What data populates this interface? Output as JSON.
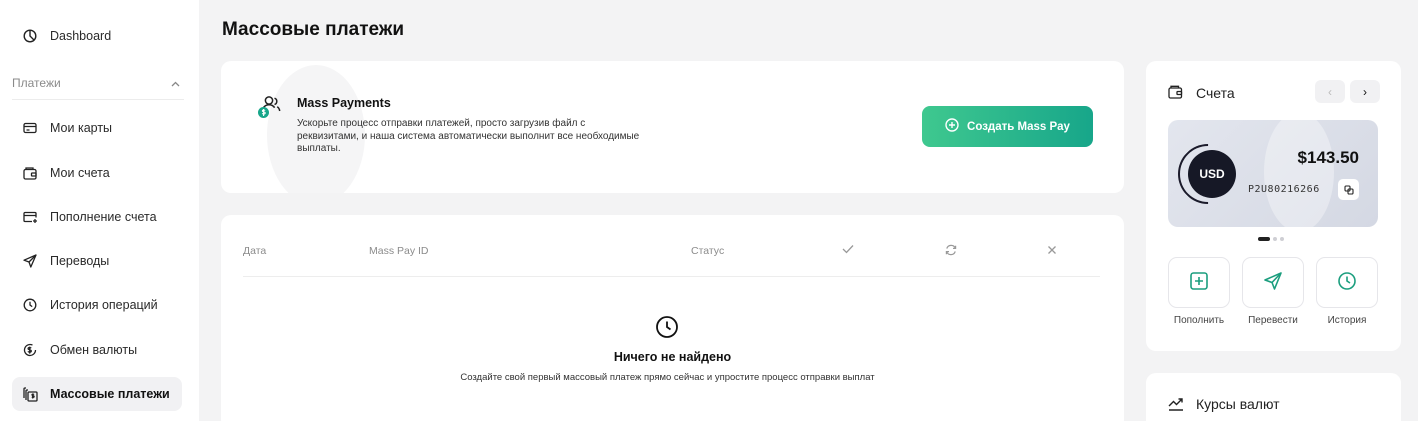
{
  "sidebar": {
    "dashboard": "Dashboard",
    "section": "Платежи",
    "items": [
      {
        "label": "Мои карты"
      },
      {
        "label": "Мои счета"
      },
      {
        "label": "Пополнение счета"
      },
      {
        "label": "Переводы"
      },
      {
        "label": "История операций"
      },
      {
        "label": "Обмен валюты"
      },
      {
        "label": "Массовые платежи"
      }
    ]
  },
  "page": {
    "title": "Массовые платежи"
  },
  "promo": {
    "title": "Mass Payments",
    "description": "Ускорьте процесс отправки платежей, просто загрузив файл с реквизитами, и наша система автоматически выполнит все необходимые выплаты.",
    "button": "Создать Mass Pay"
  },
  "table": {
    "columns": [
      "Дата",
      "Mass Pay ID",
      "Статус"
    ],
    "empty_title": "Ничего не найдено",
    "empty_desc": "Создайте свой первый массовый платеж прямо сейчас и упростите процесс отправки выплат"
  },
  "accounts": {
    "title": "Счета",
    "prev": "‹",
    "next": "›",
    "card": {
      "currency": "USD",
      "amount": "$143.50",
      "account_id": "P2U80216266"
    },
    "actions": [
      "Пополнить",
      "Перевести",
      "История"
    ]
  },
  "rates": {
    "title": "Курсы валют"
  },
  "colors": {
    "accent_start": "#3fc88f",
    "accent_end": "#17a68a",
    "action_icon": "#1b9e7e"
  }
}
